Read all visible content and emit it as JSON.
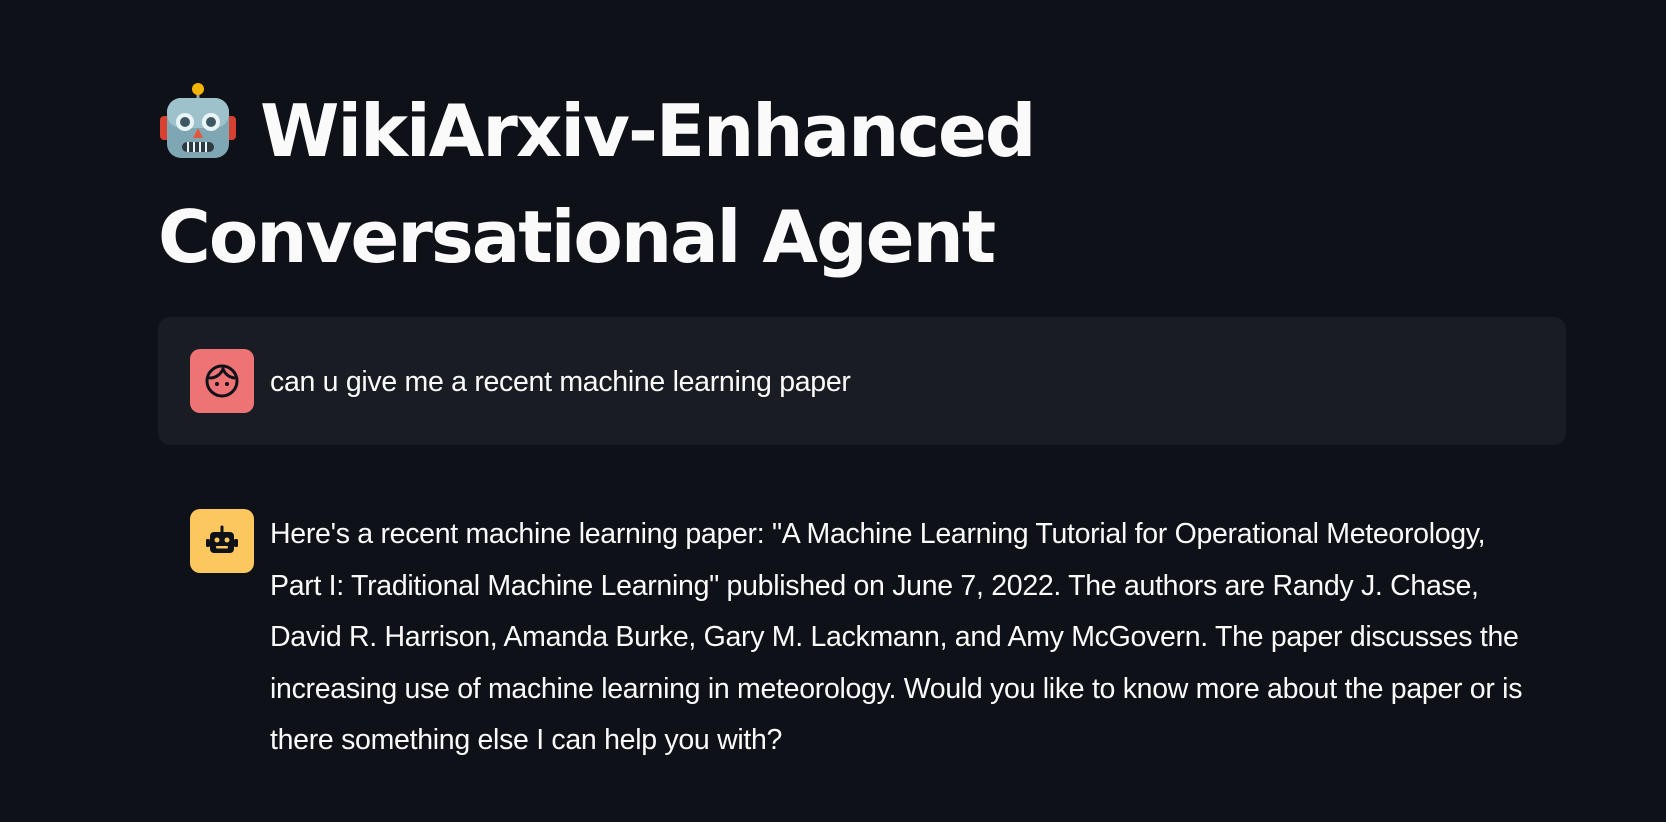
{
  "header": {
    "icon": "robot-face-emoji",
    "title": "WikiArxiv-Enhanced Conversational Agent"
  },
  "chat": {
    "messages": [
      {
        "role": "user",
        "avatar_icon": "user-face-icon",
        "avatar_color": "#ee7374",
        "text": "can u give me a recent machine learning paper"
      },
      {
        "role": "assistant",
        "avatar_icon": "robot-icon",
        "avatar_color": "#fbc75e",
        "text": "Here's a recent machine learning paper: \"A Machine Learning Tutorial for Operational Meteorology, Part I: Traditional Machine Learning\" published on June 7, 2022. The authors are Randy J. Chase, David R. Harrison, Amanda Burke, Gary M. Lackmann, and Amy McGovern. The paper discusses the increasing use of machine learning in meteorology. Would you like to know more about the paper or is there something else I can help you with?"
      }
    ]
  },
  "colors": {
    "background": "#0e1117",
    "user_message_background": "#1a1c24",
    "text": "#fafafa"
  }
}
